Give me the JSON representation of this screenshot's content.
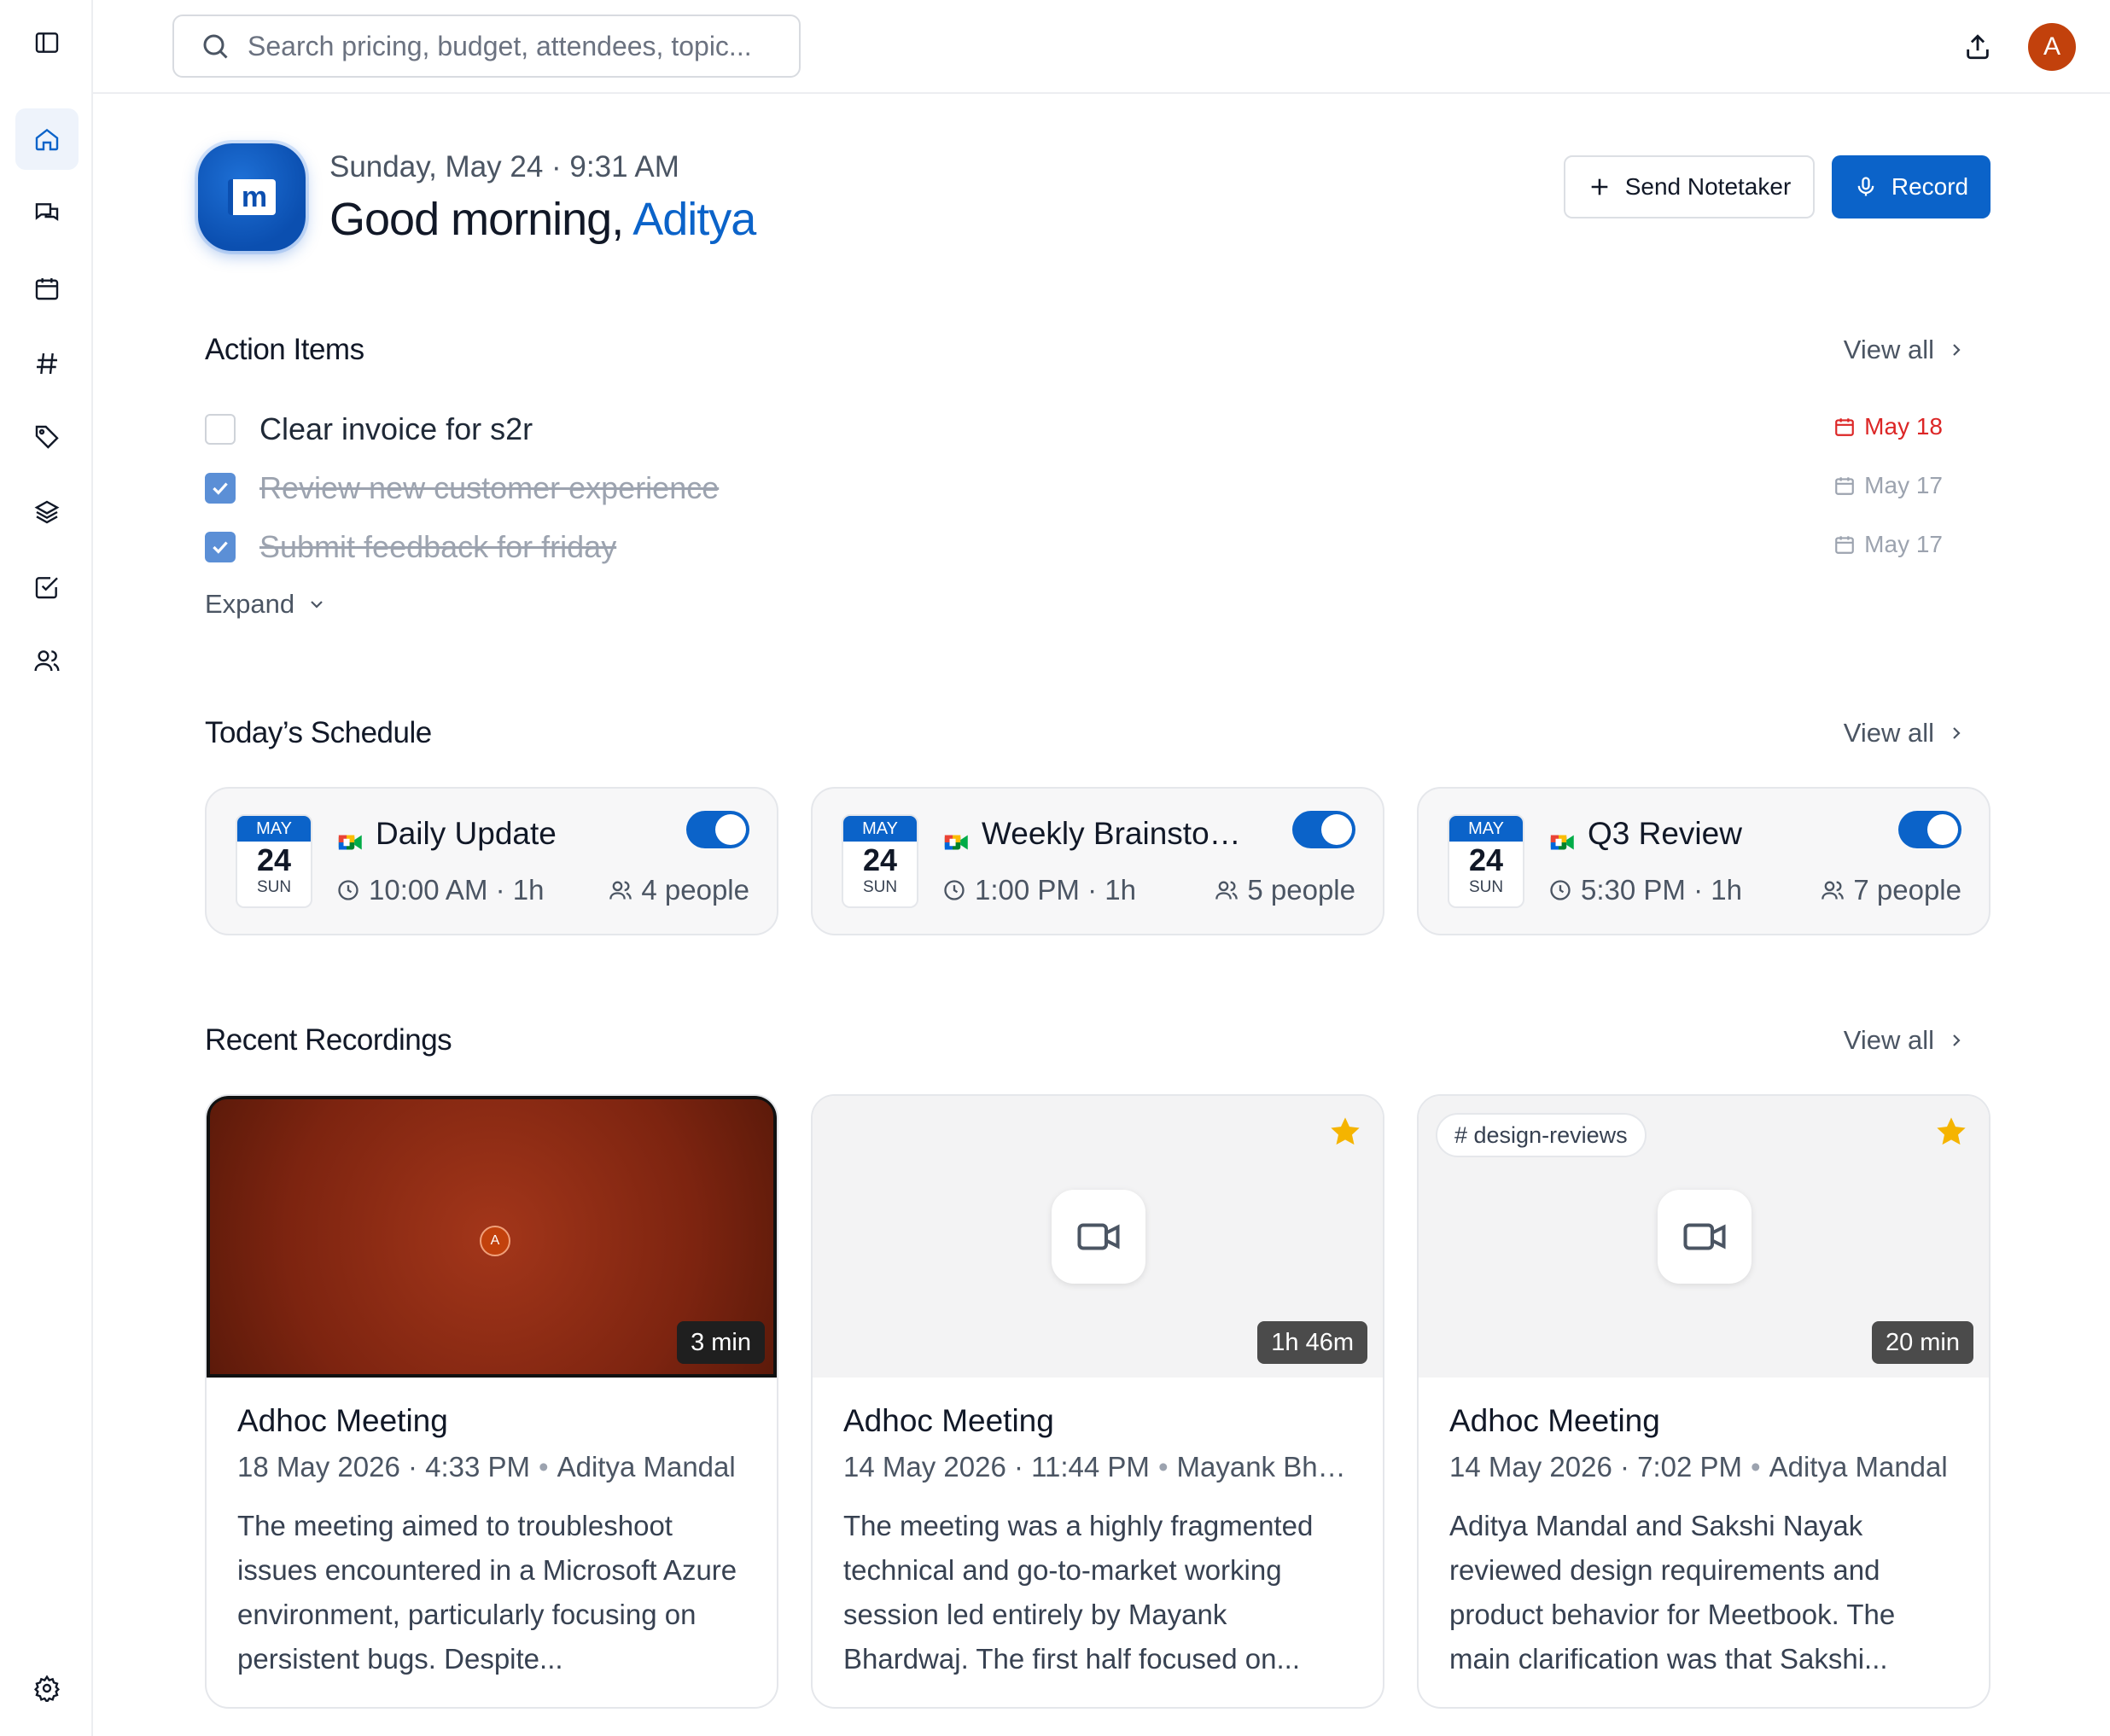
{
  "search": {
    "placeholder": "Search pricing, budget, attendees, topic..."
  },
  "user": {
    "initial": "A"
  },
  "header": {
    "datetime": "Sunday, May 24 · 9:31 AM",
    "greeting": "Good morning, ",
    "name": "Aditya",
    "send_notetaker_label": "Send Notetaker",
    "record_label": "Record"
  },
  "action_items": {
    "title": "Action Items",
    "view_all": "View all",
    "expand_label": "Expand",
    "items": [
      {
        "text": "Clear invoice for s2r",
        "due": "May 18",
        "done": false,
        "overdue": true
      },
      {
        "text": "Review new customer experience",
        "due": "May 17",
        "done": true,
        "overdue": false
      },
      {
        "text": "Submit feedback for friday",
        "due": "May 17",
        "done": true,
        "overdue": false
      }
    ]
  },
  "schedule": {
    "title": "Today’s Schedule",
    "view_all": "View all",
    "events": [
      {
        "month": "MAY",
        "day": "24",
        "weekday": "SUN",
        "title": "Daily Update",
        "time": "10:00 AM · 1h",
        "people": "4 people",
        "enabled": true
      },
      {
        "month": "MAY",
        "day": "24",
        "weekday": "SUN",
        "title": "Weekly Brainstorming",
        "time": "1:00 PM · 1h",
        "people": "5 people",
        "enabled": true
      },
      {
        "month": "MAY",
        "day": "24",
        "weekday": "SUN",
        "title": "Q3 Review",
        "time": "5:30 PM · 1h",
        "people": "7 people",
        "enabled": true
      }
    ]
  },
  "recordings": {
    "title": "Recent Recordings",
    "view_all": "View all",
    "items": [
      {
        "title": "Adhoc Meeting",
        "date": "18 May 2026 · 4:33 PM",
        "owner": "Aditya Mandal",
        "duration": "3 min",
        "summary": "The meeting aimed to troubleshoot issues encountered in a Microsoft Azure environment, particularly focusing on persistent bugs. Despite...",
        "starred": false,
        "tag": "",
        "thumb_avatar": "A"
      },
      {
        "title": "Adhoc Meeting",
        "date": "14 May 2026 · 11:44 PM",
        "owner": "Mayank Bhardwaj",
        "duration": "1h 46m",
        "summary": "The meeting was a highly fragmented technical and go-to-market working session led entirely by Mayank Bhardwaj. The first half focused on...",
        "starred": true,
        "tag": ""
      },
      {
        "title": "Adhoc Meeting",
        "date": "14 May 2026 · 7:02 PM",
        "owner": "Aditya Mandal",
        "duration": "20 min",
        "summary": "Aditya Mandal and Sakshi Nayak reviewed design requirements and product behavior for Meetbook. The main clarification was that Sakshi...",
        "starred": true,
        "tag": "# design-reviews"
      }
    ]
  },
  "colors": {
    "accent": "#0b63c9",
    "overdue": "#dc2626",
    "avatar": "#c2410c",
    "star": "#f5b400"
  }
}
